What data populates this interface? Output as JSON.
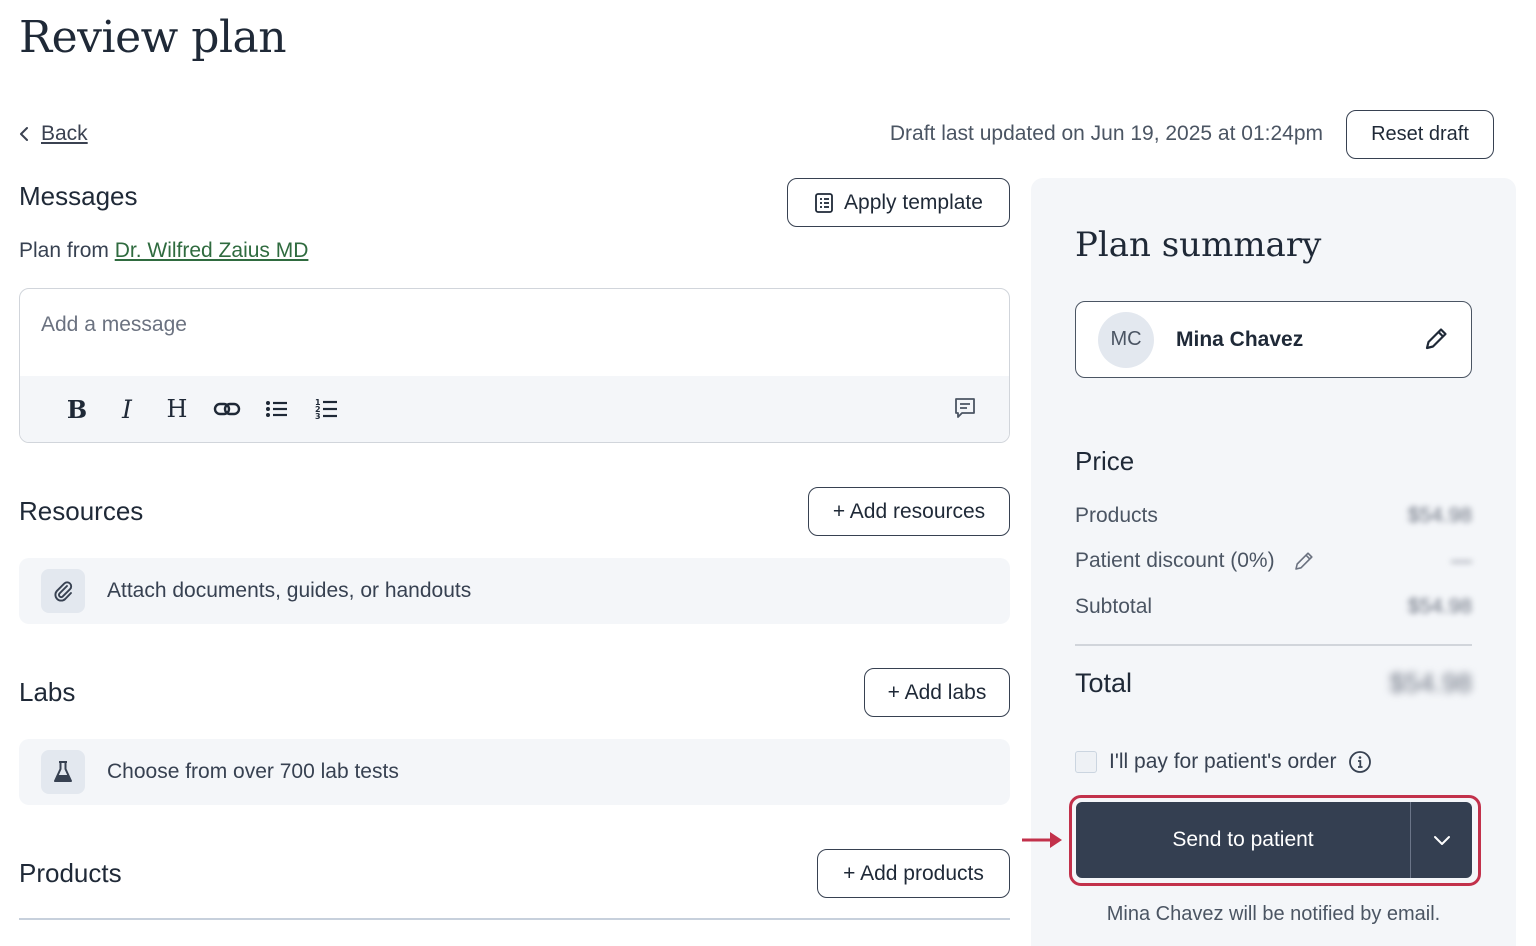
{
  "page": {
    "title": "Review plan"
  },
  "nav": {
    "back_label": "Back"
  },
  "draft": {
    "status_text": "Draft last updated on Jun 19, 2025 at 01:24pm",
    "reset_label": "Reset draft"
  },
  "messages": {
    "title": "Messages",
    "apply_template_label": "Apply template",
    "plan_from_prefix": "Plan from",
    "practitioner_name": "Dr. Wilfred Zaius MD",
    "placeholder": "Add a message",
    "toolbar": {
      "bold": "B",
      "italic": "I",
      "heading": "H"
    }
  },
  "resources": {
    "title": "Resources",
    "add_label": "+ Add resources",
    "empty_text": "Attach documents, guides, or handouts"
  },
  "labs": {
    "title": "Labs",
    "add_label": "+ Add labs",
    "empty_text": "Choose from over 700 lab tests"
  },
  "products": {
    "title": "Products",
    "add_label": "+ Add products"
  },
  "summary": {
    "title": "Plan summary",
    "patient": {
      "initials": "MC",
      "name": "Mina Chavez"
    },
    "price_title": "Price",
    "rows": [
      {
        "label": "Products",
        "value": "$54.98"
      },
      {
        "label": "Patient discount (0%)",
        "value": "—"
      },
      {
        "label": "Subtotal",
        "value": "$54.98"
      }
    ],
    "total_label": "Total",
    "total_value": "$54.98",
    "pay_label": "I'll pay for patient's order",
    "send_label": "Send to patient",
    "notify_text": "Mina Chavez will be notified by email."
  },
  "colors": {
    "primary_button": "#343f51",
    "highlight": "#c2314b",
    "link_green": "#2f6b3f",
    "panel_bg": "#f4f6f9"
  }
}
